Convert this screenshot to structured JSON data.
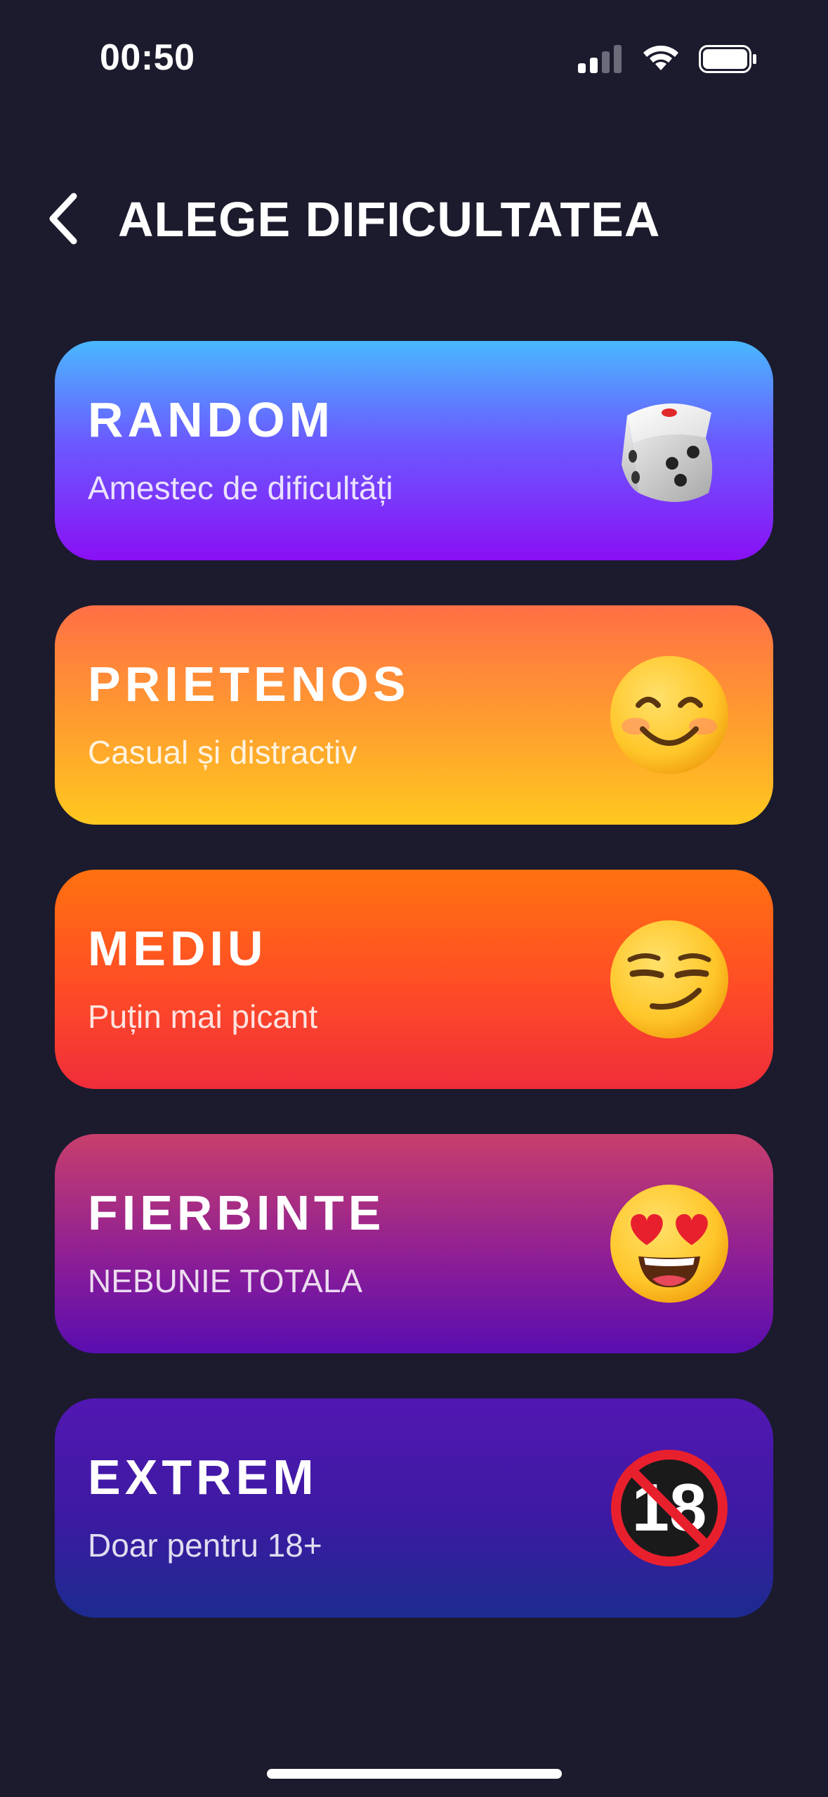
{
  "status_bar": {
    "time": "00:50",
    "icons": [
      "cellular-signal-icon",
      "wifi-icon",
      "battery-icon"
    ]
  },
  "header": {
    "back_icon": "chevron-left-icon",
    "title": "ALEGE DIFICULTATEA"
  },
  "difficulties": [
    {
      "title": "RANDOM",
      "subtitle": "Amestec de dificultăți",
      "icon": "dice-icon"
    },
    {
      "title": "PRIETENOS",
      "subtitle": "Casual și distractiv",
      "icon": "smiling-face-icon"
    },
    {
      "title": "MEDIU",
      "subtitle": "Puțin mai picant",
      "icon": "smirking-face-icon"
    },
    {
      "title": "FIERBINTE",
      "subtitle": "NEBUNIE TOTALA",
      "icon": "heart-eyes-face-icon"
    },
    {
      "title": "EXTREM",
      "subtitle": "Doar pentru 18+",
      "icon": "no-one-under-eighteen-icon"
    }
  ],
  "colors": {
    "background": "#1b1b2d",
    "random": [
      "#4ab8ff",
      "#8a10f5"
    ],
    "prietenos": [
      "#ff6f45",
      "#ffc81f"
    ],
    "mediu": [
      "#ff720f",
      "#f02d3a"
    ],
    "fierbinte": [
      "#c83f6c",
      "#5a0db0"
    ],
    "extrem": [
      "#5217b2",
      "#1c2b8f"
    ]
  }
}
